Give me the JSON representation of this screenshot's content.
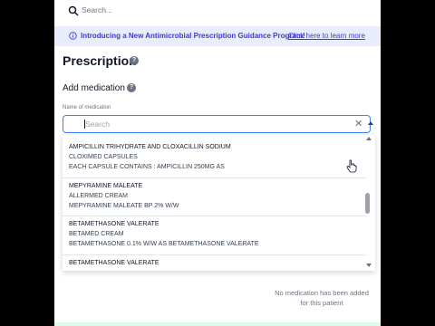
{
  "top_search": {
    "placeholder": "Search..."
  },
  "banner": {
    "text": "Introducing a New Antimicrobial Prescription Guidance Program!",
    "link": "Click here to learn more"
  },
  "page": {
    "title": "Prescription",
    "section_title": "Add medication",
    "help_glyph": "?"
  },
  "medication_field": {
    "label": "Name of medication",
    "placeholder": "Search",
    "value": ""
  },
  "dropdown_options": [
    {
      "drug": "AMPICILLIN TRIHYDRATE AND CLOXACILLIN SODIUM",
      "brand": "CLOXIMED CAPSULES",
      "detail": "EACH CAPSULE CONTAINS : AMPICILLIN 250MG AS"
    },
    {
      "drug": "MEPYRAMINE MALEATE",
      "brand": "ALLERMED CREAM",
      "detail": "MEPYRAMINE MALEATE BP 2% W/W"
    },
    {
      "drug": "BETAMETHASONE VALERATE",
      "brand": "BETAMED CREAM",
      "detail": "BETAMETHASONE 0.1% W/W AS BETAMETHASONE VALERATE"
    },
    {
      "drug": "BETAMETHASONE VALERATE",
      "brand": "",
      "detail": ""
    }
  ],
  "empty_state": {
    "line1": "No medication has been added",
    "line2": "for this patient"
  },
  "colors": {
    "accent": "#3b82f6",
    "banner_bg": "#e9ecfa",
    "banner_text": "#4338ca"
  }
}
